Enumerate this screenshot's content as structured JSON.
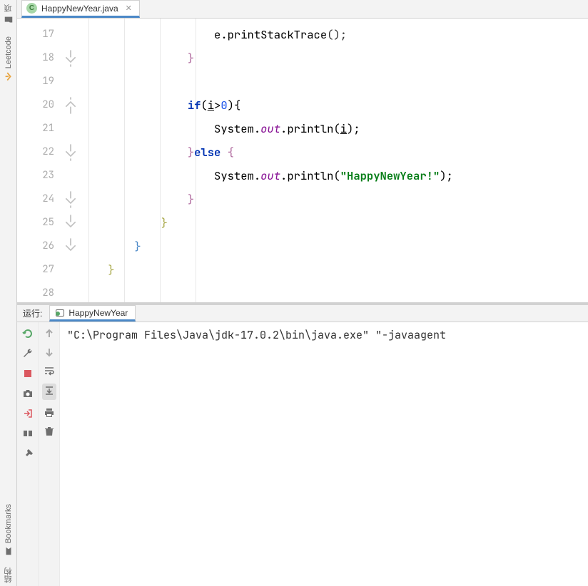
{
  "left_rail": {
    "project_label": "项",
    "leetcode_label": "Leetcode",
    "bookmarks_label": "Bookmarks",
    "structure_label": "结构"
  },
  "editor_tab": {
    "filename": "HappyNewYear.java"
  },
  "lines": [
    "17",
    "18",
    "19",
    "20",
    "21",
    "22",
    "23",
    "24",
    "25",
    "26",
    "27",
    "28"
  ],
  "code": {
    "l17a": "e.printStackTrace",
    "l17b": "();",
    "l18": "}",
    "l20a": "if",
    "l20b": "(",
    "l20c": "i",
    "l20d": ">",
    "l20e": "0",
    "l20f": "){",
    "l21a": "System.",
    "l21b": "out",
    "l21c": ".println(",
    "l21d": "i",
    "l21e": ");",
    "l22a": "}",
    "l22b": "else ",
    "l22c": "{",
    "l23a": "System.",
    "l23b": "out",
    "l23c": ".println(",
    "l23d": "\"HappyNewYear!\"",
    "l23e": ");",
    "l24": "}",
    "l25": "}",
    "l26": "}",
    "l27": "}"
  },
  "run": {
    "header_label": "运行:",
    "tab_name": "HappyNewYear",
    "output": "\"C:\\Program Files\\Java\\jdk-17.0.2\\bin\\java.exe\" \"-javaagent"
  }
}
